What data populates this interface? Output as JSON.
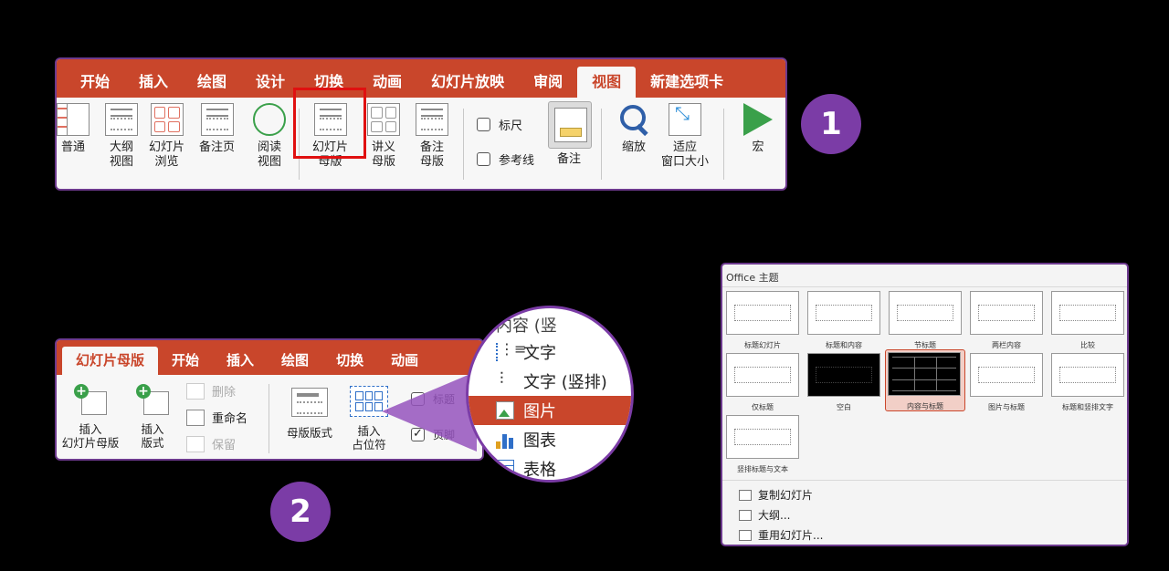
{
  "ribbon1": {
    "tabs": [
      "开始",
      "插入",
      "绘图",
      "设计",
      "切换",
      "动画",
      "幻灯片放映",
      "审阅",
      "视图",
      "新建选项卡"
    ],
    "active_tab": "视图",
    "commands": {
      "normal": "普通",
      "outline": [
        "大纲",
        "视图"
      ],
      "sorter": [
        "幻灯片",
        "浏览"
      ],
      "notes_page": "备注页",
      "reading": [
        "阅读",
        "视图"
      ],
      "slide_master": [
        "幻灯片",
        "母版"
      ],
      "handout_master": [
        "讲义",
        "母版"
      ],
      "notes_master": [
        "备注",
        "母版"
      ],
      "ruler": "标尺",
      "guides": "参考线",
      "notes": "备注",
      "zoom": "缩放",
      "fit": [
        "适应",
        "窗口大小"
      ],
      "macro": "宏"
    }
  },
  "badges": {
    "one": "1",
    "two": "2"
  },
  "ribbon2": {
    "tabs": [
      "幻灯片母版",
      "开始",
      "插入",
      "绘图",
      "切换",
      "动画"
    ],
    "active_tab": "幻灯片母版",
    "insert_master": [
      "插入",
      "幻灯片母版"
    ],
    "insert_layout": [
      "插入",
      "版式"
    ],
    "delete": "删除",
    "rename": "重命名",
    "preserve": "保留",
    "master_layout": "母版版式",
    "insert_placeholder": [
      "插入",
      "占位符"
    ],
    "title_check": "标题",
    "footer_check": "页脚"
  },
  "magnifier": {
    "partial_top": "内容 (竖",
    "items": [
      "文字",
      "文字 (竖排)",
      "图片",
      "图表",
      "表格"
    ],
    "selected": "图片"
  },
  "gallery": {
    "title": "Office 主题",
    "layouts": [
      "标题幻灯片",
      "标题和内容",
      "节标题",
      "两栏内容",
      "比较",
      "仅标题",
      "空白",
      "内容与标题",
      "图片与标题",
      "标题和竖排文字",
      "竖排标题与文本"
    ],
    "selected": "内容与标题",
    "menu": [
      "复制幻灯片",
      "大纲...",
      "重用幻灯片..."
    ]
  },
  "colors": {
    "accent": "#c9462b",
    "badge": "#7b3ca6",
    "highlight": "#e01010"
  }
}
